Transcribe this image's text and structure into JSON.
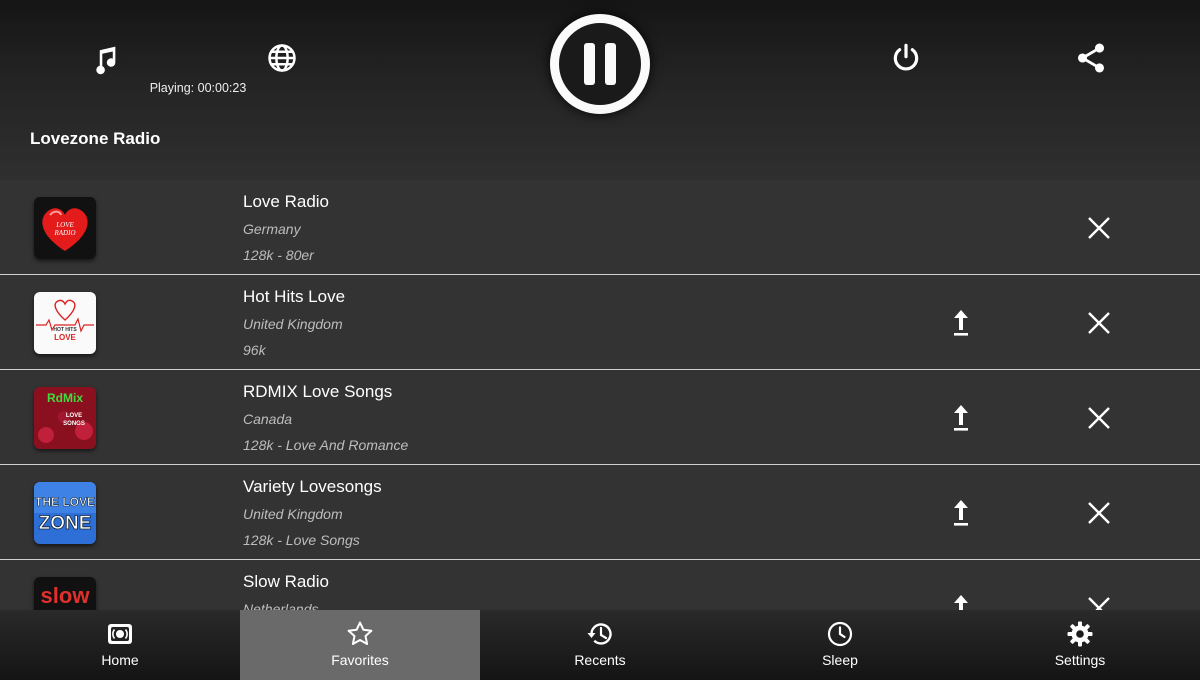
{
  "header": {
    "playing_status": "Playing: 00:00:23",
    "list_title": "Lovezone Radio"
  },
  "stations": [
    {
      "name": "Love Radio",
      "country": "Germany",
      "info": "128k - 80er",
      "logo_text": "LOVE RADIO",
      "can_move_up": false
    },
    {
      "name": "Hot Hits Love",
      "country": "United Kingdom",
      "info": "96k",
      "logo_text": "HOT HITS LOVE",
      "can_move_up": true
    },
    {
      "name": "RDMIX Love Songs",
      "country": "Canada",
      "info": "128k - Love And Romance",
      "logo_text": "RdMix LOVE SONGS",
      "can_move_up": true
    },
    {
      "name": "Variety Lovesongs",
      "country": "United Kingdom",
      "info": "128k - Love Songs",
      "logo_text": "THE LOVE ZONE",
      "can_move_up": true
    },
    {
      "name": "Slow Radio",
      "country": "Netherlands",
      "info": "",
      "logo_text": "slow",
      "can_move_up": true
    }
  ],
  "nav": [
    {
      "label": "Home",
      "icon": "radio-icon",
      "active": false
    },
    {
      "label": "Favorites",
      "icon": "star-icon",
      "active": true
    },
    {
      "label": "Recents",
      "icon": "history-icon",
      "active": false
    },
    {
      "label": "Sleep",
      "icon": "clock-icon",
      "active": false
    },
    {
      "label": "Settings",
      "icon": "gear-icon",
      "active": false
    }
  ],
  "colors": {
    "background": "#333333",
    "header_bg": "#151515",
    "active_nav": "#6a6a6a",
    "divider": "#cfcfcf",
    "secondary_text": "#bdbdbd"
  }
}
